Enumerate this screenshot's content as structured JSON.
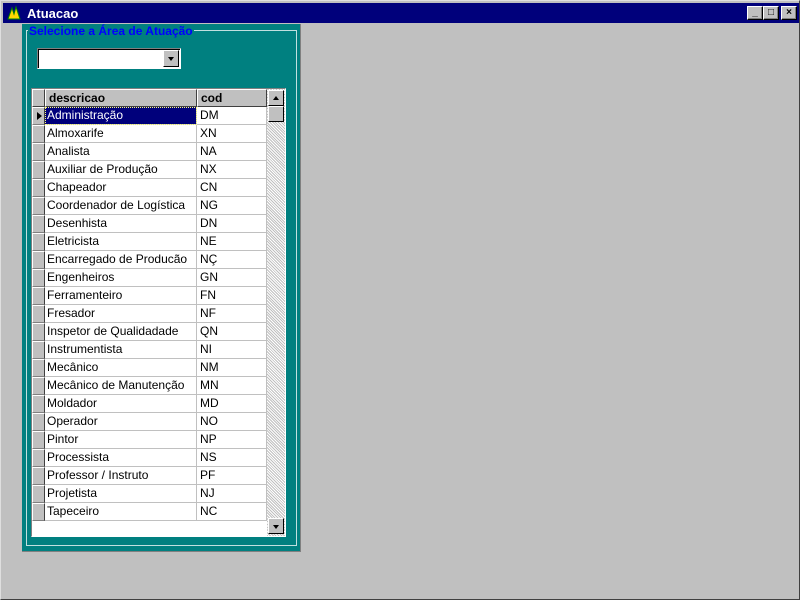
{
  "window": {
    "title": "Atuacao"
  },
  "titlebar_buttons": {
    "minimize": "_",
    "maximize": "□",
    "close": "×"
  },
  "frame": {
    "label": "Selecione  a Área de Atuação"
  },
  "combo": {
    "value": ""
  },
  "grid": {
    "columns": [
      "descricao",
      "cod"
    ],
    "selected_index": 0,
    "rows": [
      [
        "Administração",
        "DM"
      ],
      [
        "Almoxarife",
        "XN"
      ],
      [
        "Analista",
        "NA"
      ],
      [
        "Auxiliar de Produção",
        "NX"
      ],
      [
        "Chapeador",
        "CN"
      ],
      [
        "Coordenador de Logística",
        "NG"
      ],
      [
        "Desenhista",
        "DN"
      ],
      [
        "Eletricista",
        "NE"
      ],
      [
        "Encarregado de Producão",
        "NÇ"
      ],
      [
        "Engenheiros",
        "GN"
      ],
      [
        "Ferramenteiro",
        "FN"
      ],
      [
        "Fresador",
        "NF"
      ],
      [
        "Inspetor de Qualidadade",
        "QN"
      ],
      [
        "Instrumentista",
        "NI"
      ],
      [
        "Mecânico",
        "NM"
      ],
      [
        "Mecânico de Manutenção",
        "MN"
      ],
      [
        "Moldador",
        "MD"
      ],
      [
        "Operador",
        "NO"
      ],
      [
        "Pintor",
        "NP"
      ],
      [
        "Processista",
        "NS"
      ],
      [
        "Professor / Instruto",
        "PF"
      ],
      [
        "Projetista",
        "NJ"
      ],
      [
        "Tapeceiro",
        "NC"
      ]
    ]
  }
}
